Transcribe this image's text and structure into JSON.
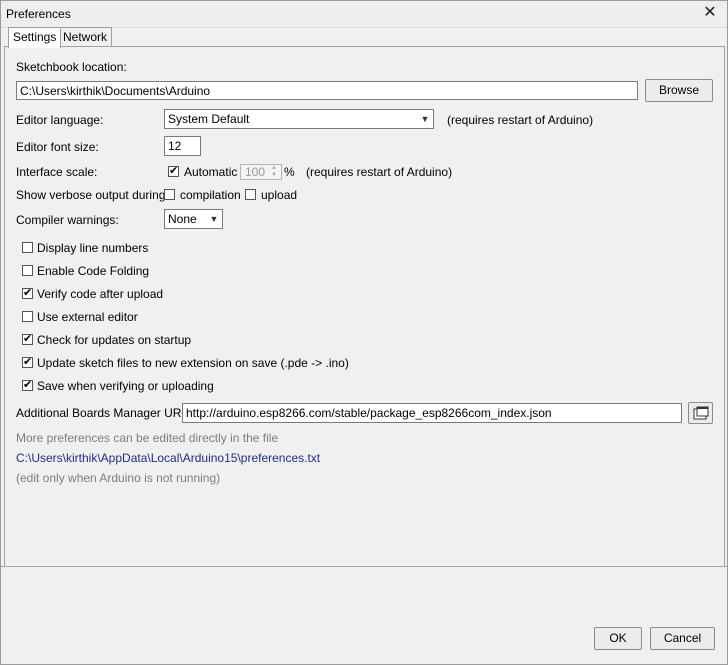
{
  "window": {
    "title": "Preferences",
    "close_symbol": "✕"
  },
  "tabs": [
    "Settings",
    "Network"
  ],
  "sketchbook": {
    "label": "Sketchbook location:",
    "value": "C:\\Users\\kirthik\\Documents\\Arduino",
    "browse": "Browse"
  },
  "language": {
    "label": "Editor language:",
    "value": "System Default",
    "note": "(requires restart of Arduino)"
  },
  "font_size": {
    "label": "Editor font size:",
    "value": "12"
  },
  "interface_scale": {
    "label": "Interface scale:",
    "automatic_label": "Automatic",
    "automatic_checked": true,
    "value": "100",
    "unit": "%",
    "note": "(requires restart of Arduino)"
  },
  "verbose": {
    "label": "Show verbose output during:",
    "compilation_label": "compilation",
    "compilation_checked": false,
    "upload_label": "upload",
    "upload_checked": false
  },
  "warnings": {
    "label": "Compiler warnings:",
    "value": "None"
  },
  "options": [
    {
      "label": "Display line numbers",
      "checked": false
    },
    {
      "label": "Enable Code Folding",
      "checked": false
    },
    {
      "label": "Verify code after upload",
      "checked": true
    },
    {
      "label": "Use external editor",
      "checked": false
    },
    {
      "label": "Check for updates on startup",
      "checked": true
    },
    {
      "label": "Update sketch files to new extension on save (.pde -> .ino)",
      "checked": true
    },
    {
      "label": "Save when verifying or uploading",
      "checked": true
    }
  ],
  "boards_urls": {
    "label": "Additional Boards Manager URLs:",
    "value": "http://arduino.esp8266.com/stable/package_esp8266com_index.json"
  },
  "more_prefs": {
    "line1": "More preferences can be edited directly in the file",
    "path": "C:\\Users\\kirthik\\AppData\\Local\\Arduino15\\preferences.txt",
    "line3": "(edit only when Arduino is not running)"
  },
  "buttons": {
    "ok": "OK",
    "cancel": "Cancel"
  }
}
